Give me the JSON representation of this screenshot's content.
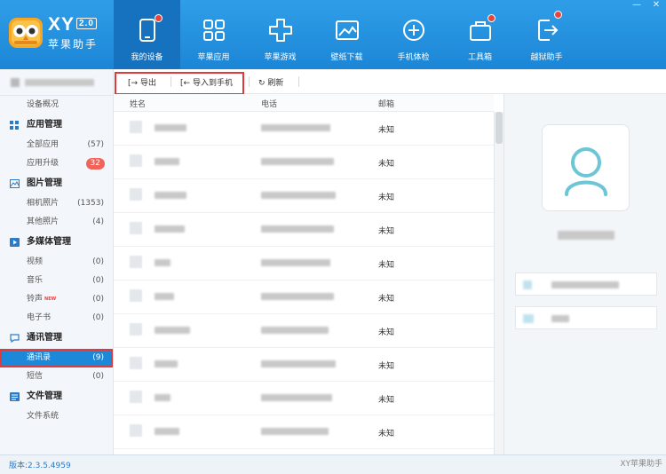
{
  "app": {
    "brand_title": "XY",
    "brand_version": "2.0",
    "brand_subtitle": "苹果助手"
  },
  "nav": [
    {
      "label": "我的设备",
      "icon": "tablet-icon",
      "active": true,
      "dot": true
    },
    {
      "label": "苹果应用",
      "icon": "apps-grid-icon",
      "active": false,
      "dot": false
    },
    {
      "label": "苹果游戏",
      "icon": "gamepad-cross-icon",
      "active": false,
      "dot": false
    },
    {
      "label": "壁纸下载",
      "icon": "wallpaper-picture-icon",
      "active": false,
      "dot": false
    },
    {
      "label": "手机体检",
      "icon": "plus-circle-icon",
      "active": false,
      "dot": false
    },
    {
      "label": "工具箱",
      "icon": "toolbox-bag-icon",
      "active": false,
      "dot": true
    },
    {
      "label": "越狱助手",
      "icon": "exit-arrow-icon",
      "active": false,
      "dot": true
    }
  ],
  "window_controls": {
    "minimize": "—",
    "close": "✕"
  },
  "sidebar": {
    "overview": "设备概况",
    "sections": [
      {
        "title": "应用管理",
        "icon": "apps-grid-icon",
        "items": [
          {
            "label": "全部应用",
            "count": "(57)"
          },
          {
            "label": "应用升级",
            "badge": "32"
          }
        ]
      },
      {
        "title": "图片管理",
        "icon": "picture-icon",
        "items": [
          {
            "label": "相机照片",
            "count": "(1353)"
          },
          {
            "label": "其他照片",
            "count": "(4)"
          }
        ]
      },
      {
        "title": "多媒体管理",
        "icon": "media-icon",
        "items": [
          {
            "label": "视频",
            "count": "(0)"
          },
          {
            "label": "音乐",
            "count": "(0)"
          },
          {
            "label": "铃声",
            "count": "(0)",
            "tag": "NEW"
          },
          {
            "label": "电子书",
            "count": "(0)"
          }
        ]
      },
      {
        "title": "通讯管理",
        "icon": "chat-bubble-icon",
        "items": [
          {
            "label": "通讯录",
            "count": "(9)",
            "selected": true
          },
          {
            "label": "短信",
            "count": "(0)"
          }
        ]
      },
      {
        "title": "文件管理",
        "icon": "file-icon",
        "items": [
          {
            "label": "文件系统"
          }
        ]
      }
    ]
  },
  "toolbar": {
    "export_label": "导出",
    "import_label": "导入到手机",
    "refresh_label": "刷新"
  },
  "table": {
    "columns": [
      "姓名",
      "电话",
      "邮箱"
    ],
    "rows": [
      {
        "email": "未知"
      },
      {
        "email": "未知"
      },
      {
        "email": "未知"
      },
      {
        "email": "未知"
      },
      {
        "email": "未知"
      },
      {
        "email": "未知"
      },
      {
        "email": "未知"
      },
      {
        "email": "未知"
      },
      {
        "email": "未知"
      },
      {
        "email": "未知"
      }
    ]
  },
  "status": {
    "version": "版本:2.3.5.4959",
    "watermark": "XY苹果助手"
  },
  "colors": {
    "topbar": "#2196e6",
    "accent": "#1e88d8",
    "badge": "#f0645a",
    "highlight": "#e0393e",
    "avatar_stroke": "#6cc6d6"
  }
}
